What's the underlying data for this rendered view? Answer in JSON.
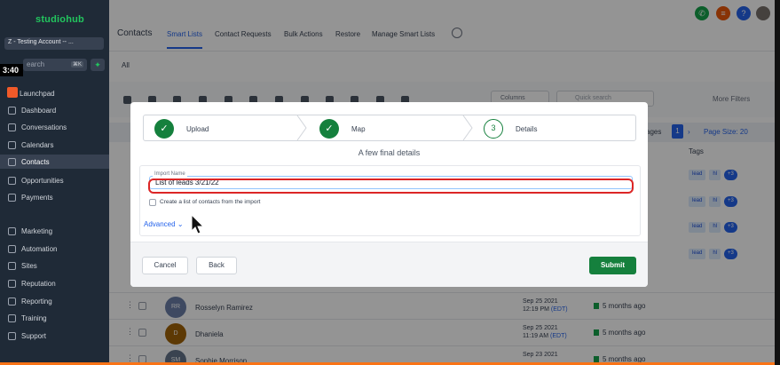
{
  "sidebar": {
    "logo": "studiohub",
    "account": "Z - Testing Account -- ...",
    "search_placeholder": "earch",
    "search_shortcut": "⌘K",
    "timer": "3:40",
    "items": [
      {
        "label": "Launchpad",
        "icon": "rocket-icon"
      },
      {
        "label": "Dashboard",
        "icon": "dashboard-icon"
      },
      {
        "label": "Conversations",
        "icon": "chat-icon"
      },
      {
        "label": "Calendars",
        "icon": "calendar-icon"
      },
      {
        "label": "Contacts",
        "icon": "contacts-icon"
      },
      {
        "label": "Opportunities",
        "icon": "funnel-icon"
      },
      {
        "label": "Payments",
        "icon": "card-icon"
      },
      {
        "label": "Marketing",
        "icon": "send-icon"
      },
      {
        "label": "Automation",
        "icon": "automation-icon"
      },
      {
        "label": "Sites",
        "icon": "globe-icon"
      },
      {
        "label": "Reputation",
        "icon": "star-icon"
      },
      {
        "label": "Reporting",
        "icon": "chart-icon"
      },
      {
        "label": "Training",
        "icon": "book-icon"
      },
      {
        "label": "Support",
        "icon": "help-icon"
      }
    ]
  },
  "header": {
    "title": "Contacts",
    "tabs": [
      "Smart Lists",
      "Contact Requests",
      "Bulk Actions",
      "Restore",
      "Manage Smart Lists"
    ],
    "all_tab": "All",
    "colors": {
      "phone": "#16a34a",
      "notify": "#ea580c",
      "help": "#2563eb"
    }
  },
  "toolbar": {
    "columns_label": "Columns",
    "quick_search_placeholder": "Quick search",
    "more_filters": "More Filters"
  },
  "table": {
    "pagination_label": "ages",
    "page": "1",
    "page_size": "Page Size: 20",
    "tags_header": "Tags",
    "tags": [
      "lead",
      "hl",
      "+3"
    ],
    "rows": [
      {
        "initials": "RR",
        "name": "Rosselyn Ramirez",
        "date": "Sep 25 2021",
        "time": "12:19 PM",
        "tz": "(EDT)",
        "ago": "5 months ago",
        "color": "#6b7fa8"
      },
      {
        "initials": "D",
        "name": "Dhaniela",
        "date": "Sep 25 2021",
        "time": "11:19 AM",
        "tz": "(EDT)",
        "ago": "5 months ago",
        "color": "#a16207"
      },
      {
        "initials": "SM",
        "name": "Sophie Morrison",
        "date": "Sep 23 2021",
        "time": "",
        "tz": "",
        "ago": "5 months ago",
        "color": "#64748b"
      }
    ]
  },
  "modal": {
    "steps": [
      {
        "label": "Upload",
        "state": "done"
      },
      {
        "label": "Map",
        "state": "done"
      },
      {
        "label": "Details",
        "state": "current",
        "number": "3"
      }
    ],
    "subtitle": "A few final details",
    "import_name_label": "Import Name",
    "import_name_value": "List of leads 3/21/22",
    "checkbox_label": "Create a list of contacts from the import",
    "advanced_label": "Advanced",
    "cancel_label": "Cancel",
    "back_label": "Back",
    "submit_label": "Submit"
  }
}
